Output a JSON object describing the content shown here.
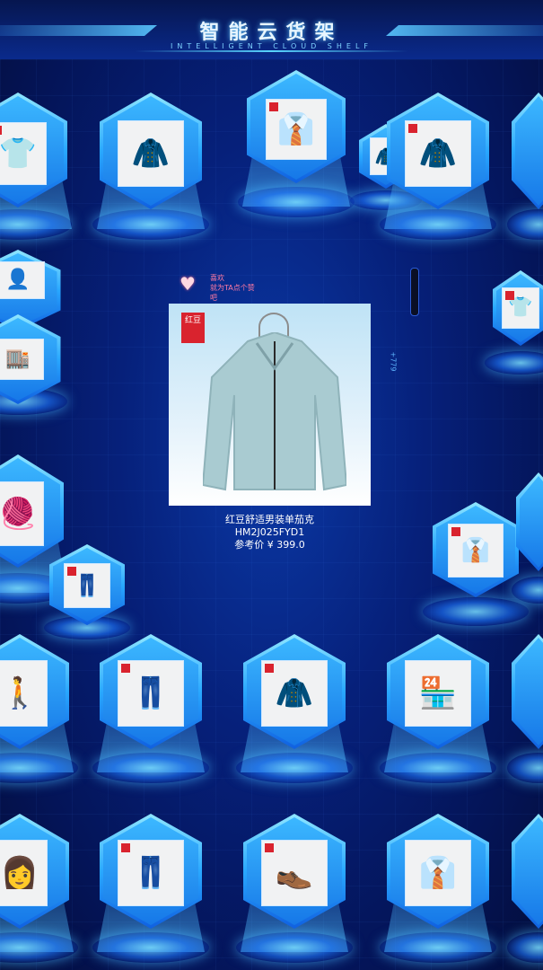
{
  "header": {
    "title": "智能云货架",
    "subtitle": "INTELLIGENT CLOUD SHELF"
  },
  "feature": {
    "brand_label": "红豆",
    "name": "红豆舒适男装单茄克HM2J025FYD1",
    "price_label": "参考价",
    "price": "¥ 399.0"
  },
  "like": {
    "line1": "喜欢",
    "line2": "就为TA点个赞吧"
  },
  "side_label": "+779",
  "shelves": [
    {
      "id": "r1-a",
      "icon": "polo-shirt-icon"
    },
    {
      "id": "r1-b",
      "icon": "man-jacket-icon"
    },
    {
      "id": "r1-c",
      "icon": "folded-shirts-icon"
    },
    {
      "id": "r1-d",
      "icon": "man-coat-icon"
    },
    {
      "id": "r2-a",
      "icon": "store-front-icon"
    },
    {
      "id": "r2-b",
      "icon": "folded-shirt-icon"
    },
    {
      "id": "r3-a",
      "icon": "man-sweater-icon"
    },
    {
      "id": "r3-b",
      "icon": "folded-clothes-icon"
    },
    {
      "id": "r3-c",
      "icon": "folded-shirts-icon"
    },
    {
      "id": "r4-a",
      "icon": "man-walking-icon"
    },
    {
      "id": "r4-b",
      "icon": "pants-rack-icon"
    },
    {
      "id": "r4-c",
      "icon": "black-jacket-icon"
    },
    {
      "id": "r4-d",
      "icon": "store-front-icon"
    },
    {
      "id": "r5-a",
      "icon": "woman-model-icon"
    },
    {
      "id": "r5-b",
      "icon": "folded-pants-icon"
    },
    {
      "id": "r5-c",
      "icon": "leather-shoes-icon"
    },
    {
      "id": "r5-d",
      "icon": "man-shirt-icon"
    }
  ]
}
